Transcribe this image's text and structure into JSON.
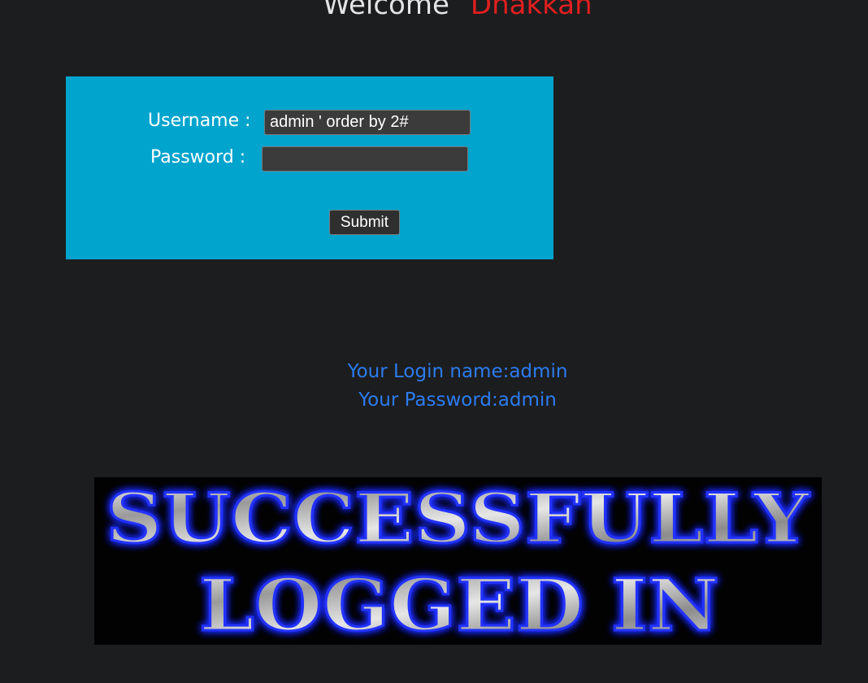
{
  "header": {
    "welcome": "Welcome",
    "name": "Dhakkan"
  },
  "login_form": {
    "username_label": "Username :",
    "username_value": "admin ' order by 2#",
    "password_label": "Password :",
    "password_value": "",
    "submit_label": "Submit"
  },
  "result": {
    "login_name": "Your Login name:admin",
    "password": "Your Password:admin"
  },
  "banner": {
    "line1": "SUCCESSFULLY",
    "line2": "LOGGED IN"
  },
  "colors": {
    "page_background": "#1c1d1f",
    "panel_background": "#00a4cd",
    "welcome_text": "#e4e4e4",
    "name_text": "#e21f1f",
    "result_text": "#2c7cf0",
    "banner_glow": "#1e2bff"
  }
}
